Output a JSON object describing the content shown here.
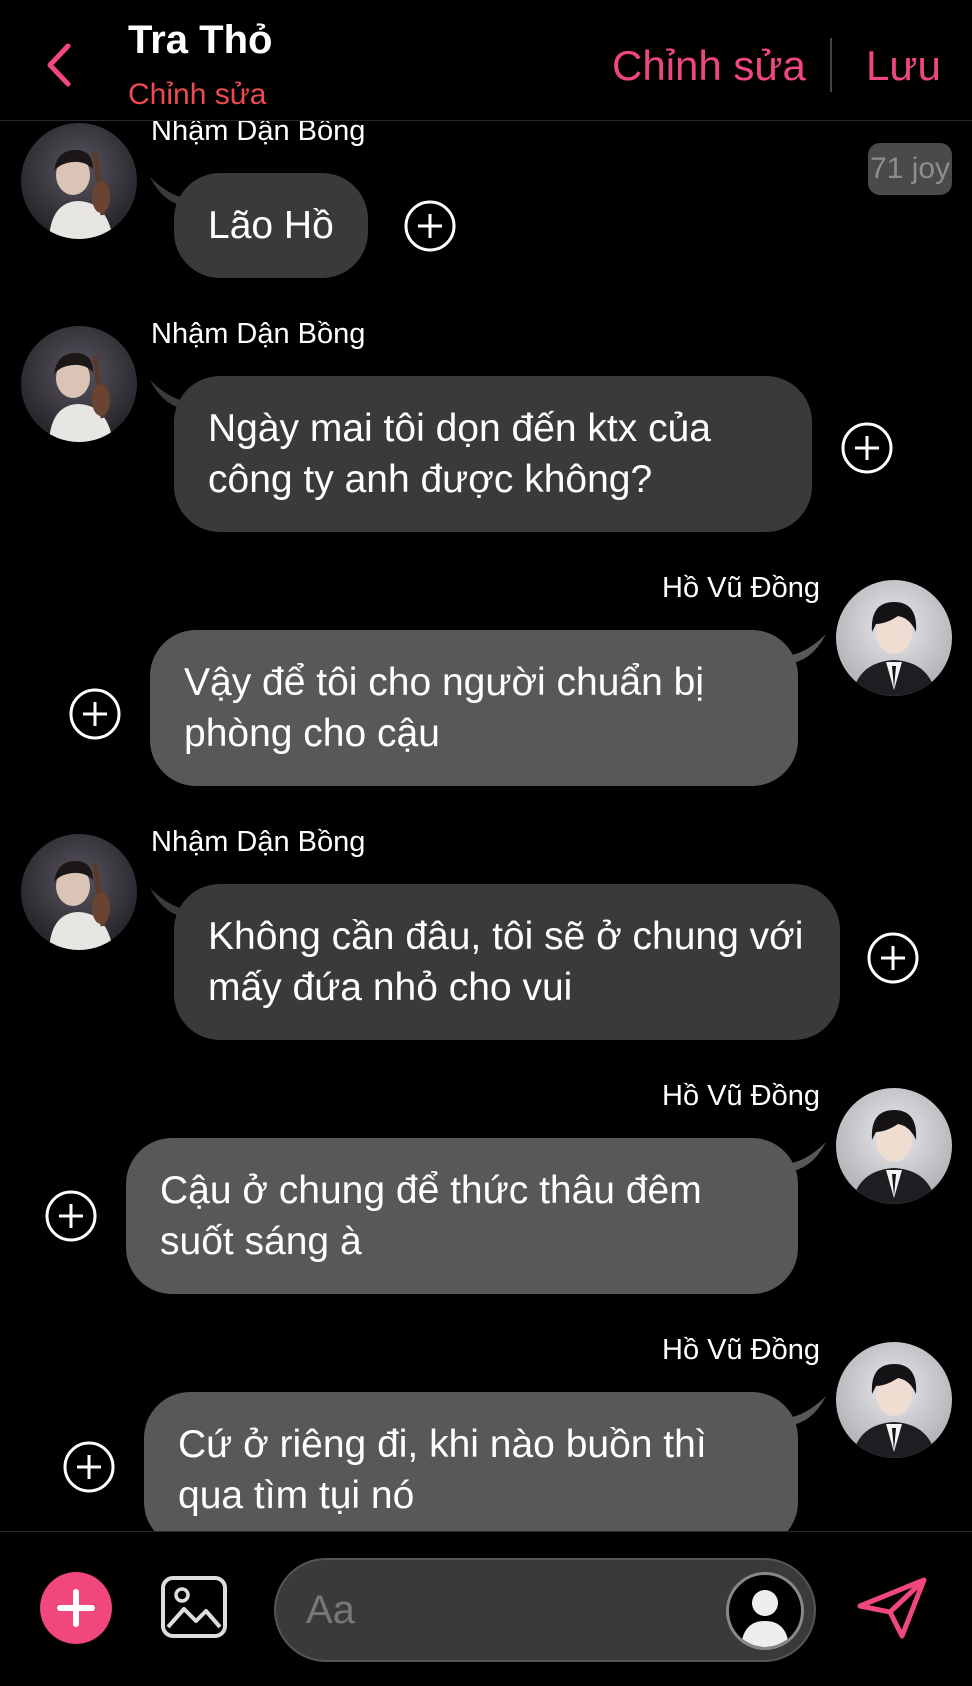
{
  "header": {
    "title": "Tra Thỏ",
    "subtitle": "Chỉnh sửa",
    "edit_label": "Chỉnh sửa",
    "save_label": "Lưu"
  },
  "badge": "71 joy",
  "messages": [
    {
      "sender": "Nhậm Dận Bồng",
      "side": "left",
      "text": "Lão Hồ"
    },
    {
      "sender": "Nhậm Dận Bồng",
      "side": "left",
      "text": "Ngày mai tôi dọn đến ktx của công ty anh được không?"
    },
    {
      "sender": "Hồ Vũ Đồng",
      "side": "right",
      "text": "Vậy để tôi cho người chuẩn bị phòng cho cậu"
    },
    {
      "sender": "Nhậm Dận Bồng",
      "side": "left",
      "text": "Không cần đâu, tôi sẽ ở chung với mấy đứa nhỏ cho vui"
    },
    {
      "sender": "Hồ Vũ Đồng",
      "side": "right",
      "text": "Cậu ở chung để thức thâu đêm suốt sáng à"
    },
    {
      "sender": "Hồ Vũ Đồng",
      "side": "right",
      "text": "Cứ ở riêng đi, khi nào buồn thì qua tìm tụi nó"
    }
  ],
  "composer": {
    "placeholder": "Aa"
  },
  "icons": {
    "back": "chevron-left-icon",
    "add": "plus-icon",
    "image": "image-icon",
    "send": "send-icon",
    "add_reaction": "plus-circle-icon"
  },
  "colors": {
    "accent": "#f0477c",
    "subtitle": "#ee4a4f",
    "bubble_left": "#3a3a3c",
    "bubble_right": "#58585a"
  }
}
